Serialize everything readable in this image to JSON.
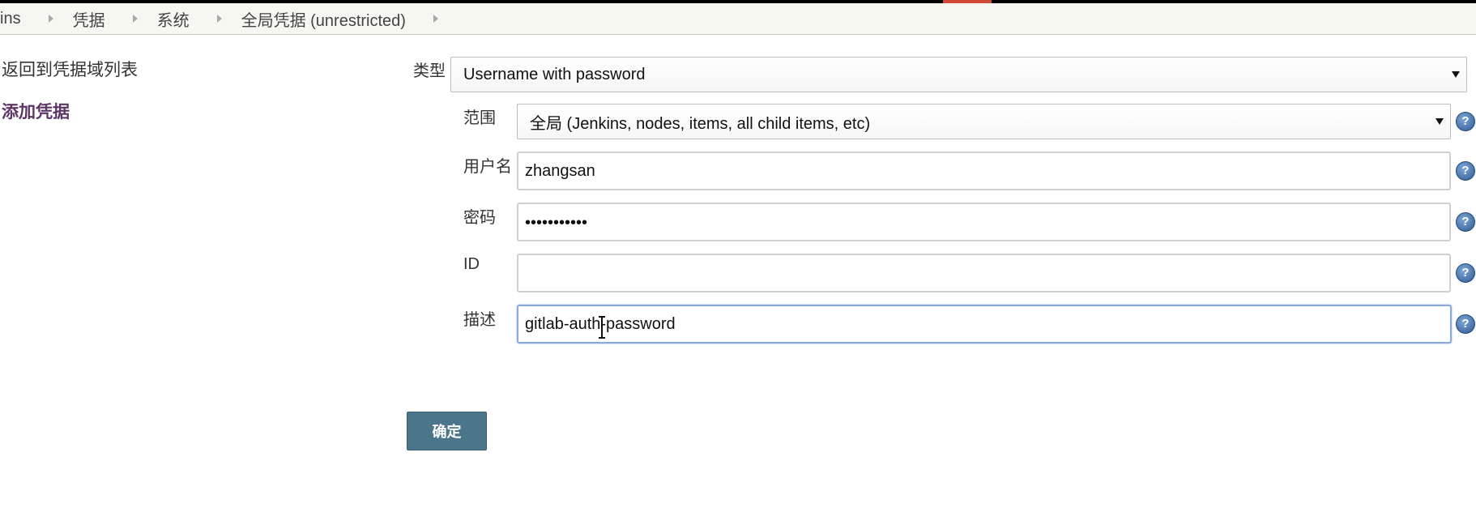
{
  "breadcrumb": {
    "items": [
      "ins",
      "凭据",
      "系统",
      "全局凭据 (unrestricted)"
    ]
  },
  "sidebar": {
    "items": [
      {
        "label": "返回到凭据域列表"
      },
      {
        "label": "添加凭据"
      }
    ]
  },
  "form": {
    "kind": {
      "label": "类型",
      "value": "Username with password"
    },
    "scope": {
      "label": "范围",
      "value": "全局 (Jenkins, nodes, items, all child items, etc)"
    },
    "username": {
      "label": "用户名",
      "value": "zhangsan"
    },
    "password": {
      "label": "密码",
      "masked": "•••••••••••"
    },
    "id": {
      "label": "ID",
      "value": ""
    },
    "description": {
      "label": "描述",
      "value": "gitlab-auth-password"
    },
    "help_symbol": "?",
    "submit_label": "确定"
  },
  "colors": {
    "accent": "#d24939",
    "active_link": "#5c3566",
    "submit_button": "#4b758b",
    "help_icon": "#2e5a93",
    "focus_border": "#8aa8d8"
  },
  "icons": [
    "chevron-right-icon",
    "dropdown-caret-icon",
    "help-icon",
    "text-cursor-icon"
  ]
}
